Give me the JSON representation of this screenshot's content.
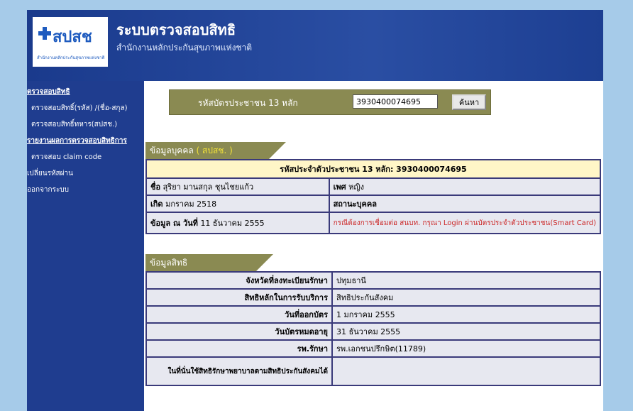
{
  "header": {
    "logo_text": "สปสช",
    "logo_sub": "สำนักงานหลักประกันสุขภาพแห่งชาติ",
    "title": "ระบบตรวจสอบสิทธิ",
    "subtitle": "สำนักงานหลักประกันสุขภาพแห่งชาติ"
  },
  "sidebar": {
    "items": [
      {
        "label": "ตรวจสอบสิทธิ",
        "style": "head"
      },
      {
        "label": "ตรวจสอบสิทธิ์(รหัส) /(ชื่อ-สกุล)",
        "style": "sub"
      },
      {
        "label": "ตรวจสอบสิทธิ์ทหาร(สปสช.)",
        "style": "sub"
      },
      {
        "label": "รายงานผลการตรวจสอบสิทธิการ",
        "style": "head"
      },
      {
        "label": "ตรวจสอบ claim code",
        "style": "sub"
      },
      {
        "label": "เปลี่ยนรหัสผ่าน",
        "style": "plain"
      },
      {
        "label": "ออกจากระบบ",
        "style": "plain"
      }
    ]
  },
  "search": {
    "label": "รหัสบัตรประชาชน 13 หลัก",
    "value": "3930400074695",
    "button": "ค้นหา"
  },
  "person": {
    "tab_label": "ข้อมูลบุคคล",
    "tab_accent": "( สปสช. )",
    "id_line": "รหัสประจำตัวประชาชน 13 หลัก: 3930400074695",
    "name_label": "ชื่อ",
    "name_value": "สุริยา มานสกุล ชุนไชยแก้ว",
    "sex_label": "เพศ",
    "sex_value": "หญิง",
    "birth_label": "เกิด",
    "birth_value": "มกราคม 2518",
    "status_label": "สถานะบุคคล",
    "data_label": "ข้อมูล ณ วันที่",
    "data_value": "11 ธันวาคม 2555",
    "warning": "กรณีต้องการเชื่อมต่อ สนบท. กรุณา Login ผ่านบัตรประจำตัวประชาชน(Smart Card)"
  },
  "rights": {
    "tab_label": "ข้อมูลสิทธิ",
    "rows": [
      {
        "label": "จังหวัดที่ลงทะเบียนรักษา",
        "value": "ปทุมธานี"
      },
      {
        "label": "สิทธิหลักในการรับบริการ",
        "value": "สิทธิประกันสังคม"
      },
      {
        "label": "วันที่ออกบัตร",
        "value": "1 มกราคม 2555"
      },
      {
        "label": "วันบัตรหมดอายุ",
        "value": "31 ธันวาคม 2555"
      },
      {
        "label": "รพ.รักษา",
        "value": "รพ.เอกชนปรึกษิต(11789)"
      },
      {
        "label": "ในที่นั่นใช้สิทธิรักษาพยาบาลตามสิทธิประกันสังคมได้",
        "value": ""
      }
    ]
  }
}
